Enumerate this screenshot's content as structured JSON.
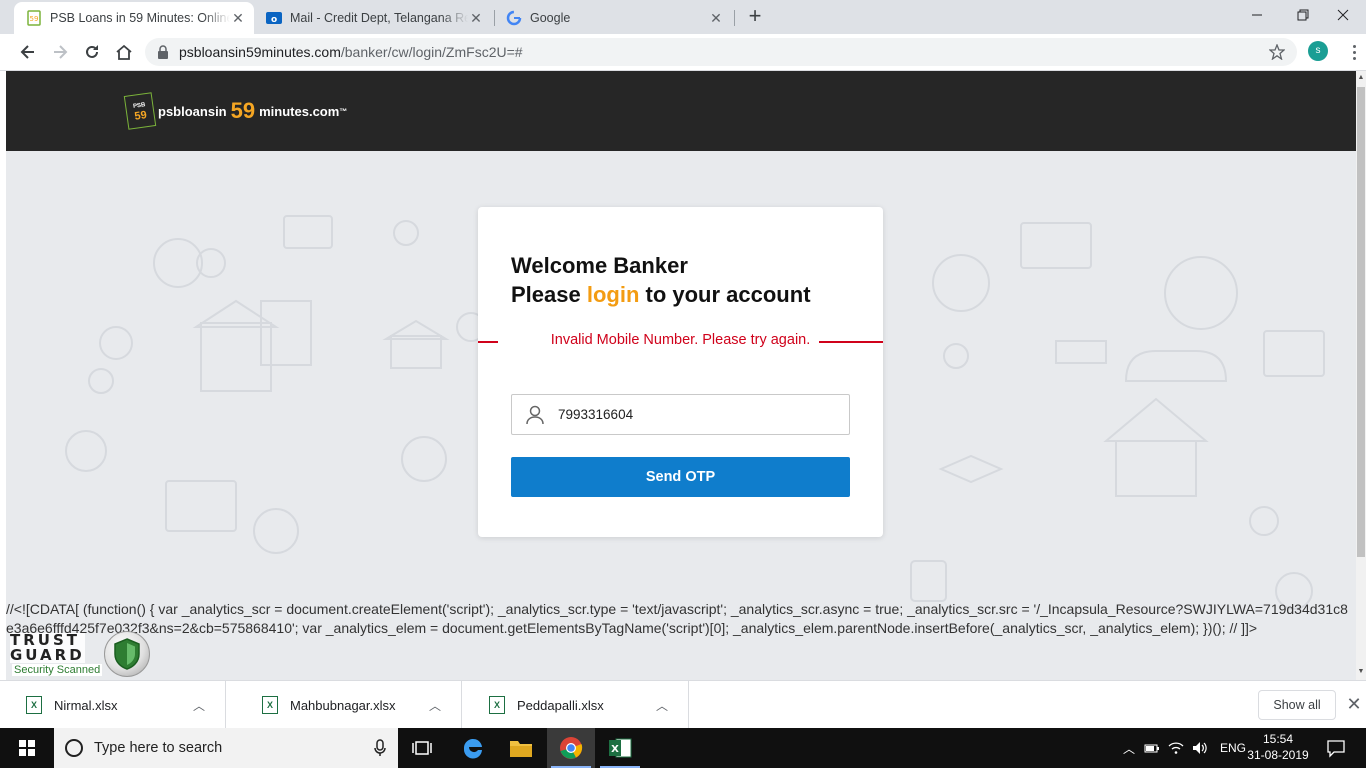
{
  "browser": {
    "tabs": [
      {
        "title": "PSB Loans in 59 Minutes: Online",
        "active": true,
        "favicon": "psb-favicon"
      },
      {
        "title": "Mail - Credit Dept, Telangana Re",
        "active": false,
        "favicon": "outlook-icon"
      },
      {
        "title": "Google",
        "active": false,
        "favicon": "google-icon"
      }
    ],
    "url_host": "psbloansin59minutes.com",
    "url_path": "/banker/cw/login/ZmFsc2U=#",
    "profile_initial": "s"
  },
  "site": {
    "logo_prefix": "psbloansin",
    "logo_number": "59",
    "logo_suffix": "minutes.com",
    "logo_tm": "™",
    "logo_badge_top": "PSB",
    "logo_badge_num": "59"
  },
  "login": {
    "heading_line1": "Welcome Banker",
    "heading_pre": "Please ",
    "heading_accent": "login",
    "heading_post": " to your account",
    "error": "Invalid Mobile Number. Please try again.",
    "mobile_value": "7993316604",
    "button": "Send OTP",
    "accent_color": "#f39c12",
    "error_color": "#d0021b",
    "button_color": "#0f7dcc"
  },
  "raw_script": "//<![CDATA[ (function() { var _analytics_scr = document.createElement('script'); _analytics_scr.type = 'text/javascript'; _analytics_scr.async = true; _analytics_scr.src = '/_Incapsula_Resource?SWJIYLWA=719d34d31c8e3a6e6fffd425f7e032f3&ns=2&cb=575868410'; var _analytics_elem = document.getElementsByTagName('script')[0]; _analytics_elem.parentNode.insertBefore(_analytics_scr, _analytics_elem); })(); // ]]>",
  "trust_guard": {
    "line1": "TRUST",
    "line2": "GUARD",
    "sub": "Security Scanned"
  },
  "downloads": {
    "items": [
      {
        "name": "Nirmal.xlsx"
      },
      {
        "name": "Mahbubnagar.xlsx"
      },
      {
        "name": "Peddapalli.xlsx"
      }
    ],
    "show_all": "Show all",
    "file_badge": "X"
  },
  "taskbar": {
    "search_placeholder": "Type here to search",
    "language": "ENG",
    "time": "15:54",
    "date": "31-08-2019"
  }
}
